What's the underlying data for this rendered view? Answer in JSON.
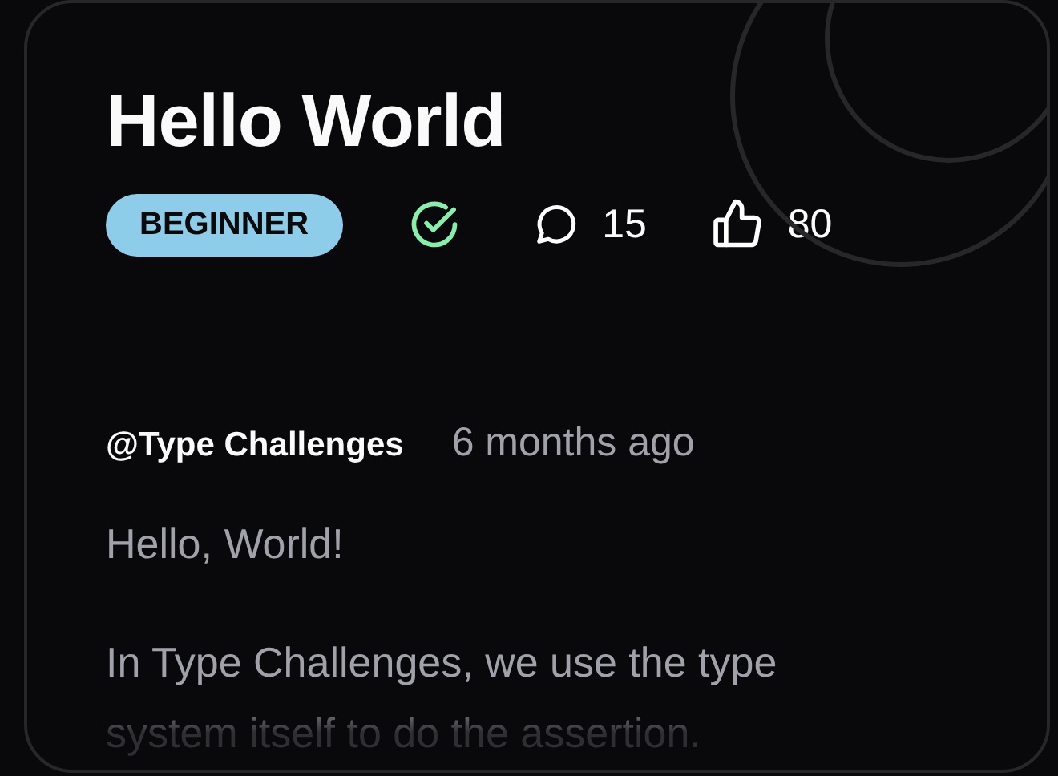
{
  "title": "Hello World",
  "difficulty": {
    "label": "BEGINNER"
  },
  "solved": true,
  "comments": "15",
  "likes": "80",
  "author": "@Type Challenges",
  "time": "6 months ago",
  "description": [
    "Hello, World!",
    "In Type Challenges, we use the type system itself to do the assertion."
  ]
}
